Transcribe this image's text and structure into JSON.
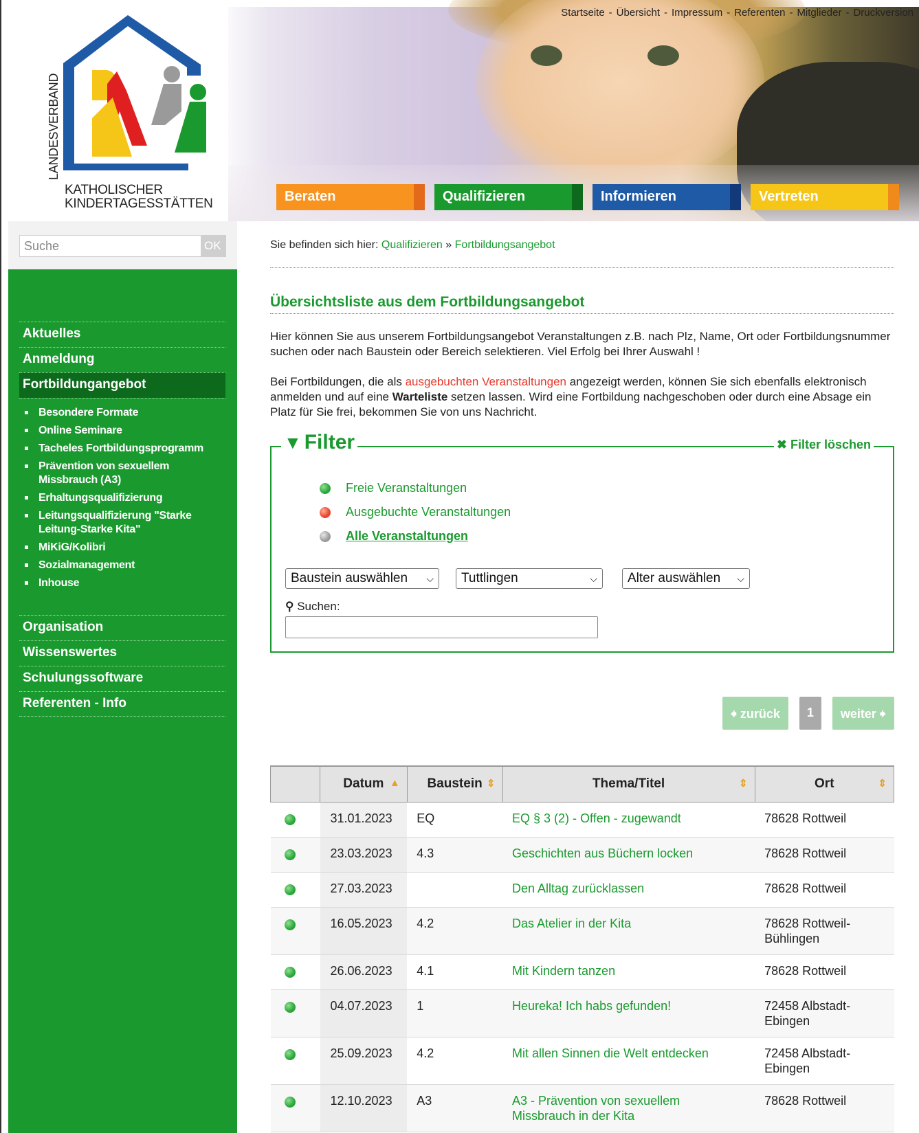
{
  "top_nav": {
    "items": [
      "Startseite",
      "Übersicht",
      "Impressum",
      "Referenten",
      "Mitglieder",
      "Druckversion"
    ]
  },
  "logo": {
    "vertical_text": "LANDESVERBAND",
    "line1": "KATHOLISCHER",
    "line2": "KINDERTAGESSTÄTTEN"
  },
  "main_nav": [
    {
      "label": "Beraten",
      "color": "#f7931e",
      "edge": "#e26a1a"
    },
    {
      "label": "Qualifizieren",
      "color": "#1a9a2e",
      "edge": "#0d6a1d"
    },
    {
      "label": "Informieren",
      "color": "#1f5aa6",
      "edge": "#123a7a"
    },
    {
      "label": "Vertreten",
      "color": "#f5c518",
      "edge": "#f08a1a"
    }
  ],
  "search": {
    "placeholder": "Suche",
    "button": "OK"
  },
  "sidebar": {
    "items_top": [
      "Aktuelles",
      "Anmeldung",
      "Fortbildungangebot"
    ],
    "active": "Fortbildungangebot",
    "sub_items": [
      "Besondere Formate",
      "Online Seminare",
      "Tacheles Fortbildungsprogramm",
      "Prävention von sexuellem Missbrauch (A3)",
      "Erhaltungsqualifizierung",
      "Leitungsqualifizierung \"Starke Leitung-Starke Kita\"",
      "MiKiG/Kolibri",
      "Sozialmanagement",
      "Inhouse"
    ],
    "items_bottom": [
      "Organisation",
      "Wissenswertes",
      "Schulungssoftware",
      "Referenten - Info"
    ]
  },
  "breadcrumb": {
    "prefix": "Sie befinden sich hier:",
    "level1": "Qualifizieren",
    "sep": "»",
    "level2": "Fortbildungsangebot"
  },
  "heading": "Übersichtsliste aus dem Fortbildungsangebot",
  "intro": "Hier können Sie aus unserem Fortbildungsangebot Veranstaltungen z.B. nach Plz, Name, Ort oder Fortbildungsnummer suchen oder nach Baustein oder Bereich selektieren. Viel Erfolg bei Ihrer Auswahl !",
  "notice": {
    "part1": "Bei Fortbildungen, die als ",
    "red": "ausgebuchten Veranstaltungen",
    "part2": " angezeigt werden, können Sie sich ebenfalls elektronisch anmelden und auf eine ",
    "bold": "Warteliste",
    "part3": " setzen lassen. Wird eine Fortbildung nachgeschoben oder durch eine Absage ein Platz für Sie frei, bekommen Sie von uns Nachricht."
  },
  "filter": {
    "title": "Filter",
    "clear": "Filter löschen",
    "statuses": [
      {
        "label": "Freie Veranstaltungen",
        "color": "green"
      },
      {
        "label": "Ausgebuchte Veranstaltungen",
        "color": "red"
      },
      {
        "label": "Alle Veranstaltungen",
        "color": "grey"
      }
    ],
    "select_baustein": "Baustein auswählen",
    "select_ort": "Tuttlingen",
    "select_alter": "Alter auswählen",
    "search_label": "Suchen:",
    "search_value": ""
  },
  "pager": {
    "prev": "zurück",
    "page": "1",
    "next": "weiter"
  },
  "table": {
    "headers": [
      "",
      "Datum",
      "Baustein",
      "Thema/Titel",
      "Ort"
    ],
    "rows": [
      {
        "date": "31.01.2023",
        "baustein": "EQ",
        "title": "EQ § 3 (2) - Offen - zugewandt",
        "ort": "78628 Rottweil"
      },
      {
        "date": "23.03.2023",
        "baustein": "4.3",
        "title": "Geschichten aus Büchern locken",
        "ort": "78628 Rottweil"
      },
      {
        "date": "27.03.2023",
        "baustein": "",
        "title": "Den Alltag zurücklassen",
        "ort": "78628 Rottweil"
      },
      {
        "date": "16.05.2023",
        "baustein": "4.2",
        "title": "Das Atelier in der Kita",
        "ort": "78628 Rottweil-Bühlingen"
      },
      {
        "date": "26.06.2023",
        "baustein": "4.1",
        "title": "Mit Kindern tanzen",
        "ort": "78628 Rottweil"
      },
      {
        "date": "04.07.2023",
        "baustein": "1",
        "title": "Heureka! Ich habs gefunden!",
        "ort": "72458 Albstadt-Ebingen"
      },
      {
        "date": "25.09.2023",
        "baustein": "4.2",
        "title": "Mit allen Sinnen die Welt entdecken",
        "ort": "72458 Albstadt-Ebingen"
      },
      {
        "date": "12.10.2023",
        "baustein": "A3",
        "title": "A3 - Prävention von sexuellem Missbrauch in der Kita",
        "ort": "78628 Rottweil"
      }
    ]
  }
}
